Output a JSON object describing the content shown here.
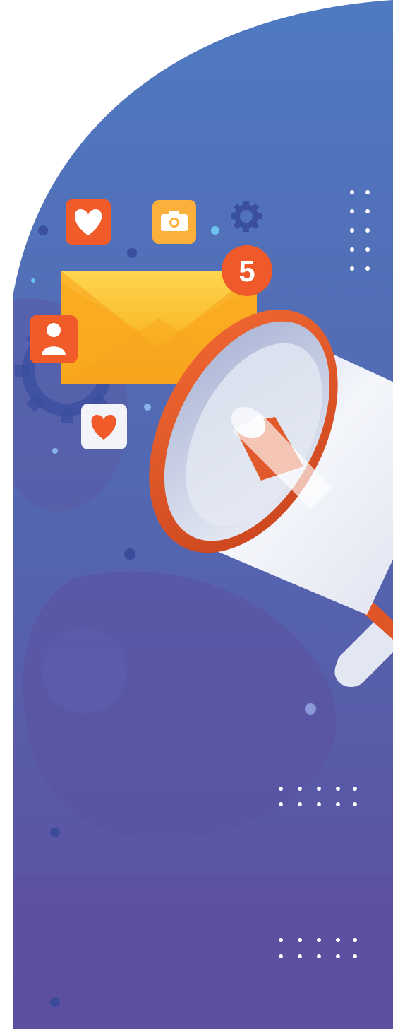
{
  "illustration": {
    "subject": "megaphone-notification-banner",
    "notification_badge": "5",
    "icons": [
      "heart-icon",
      "camera-icon",
      "gear-icon",
      "envelope-icon",
      "user-icon",
      "heart-icon",
      "megaphone-icon"
    ]
  },
  "colors": {
    "background_top": "#4f78bf",
    "background_bottom": "#5d4f9f",
    "envelope": "#f9b323",
    "badge": "#f05a2b",
    "icon_orange": "#f15a29",
    "icon_yellow": "#fbb03b",
    "megaphone_rim": "#e8572a",
    "megaphone_body": "#e9ecf5"
  }
}
